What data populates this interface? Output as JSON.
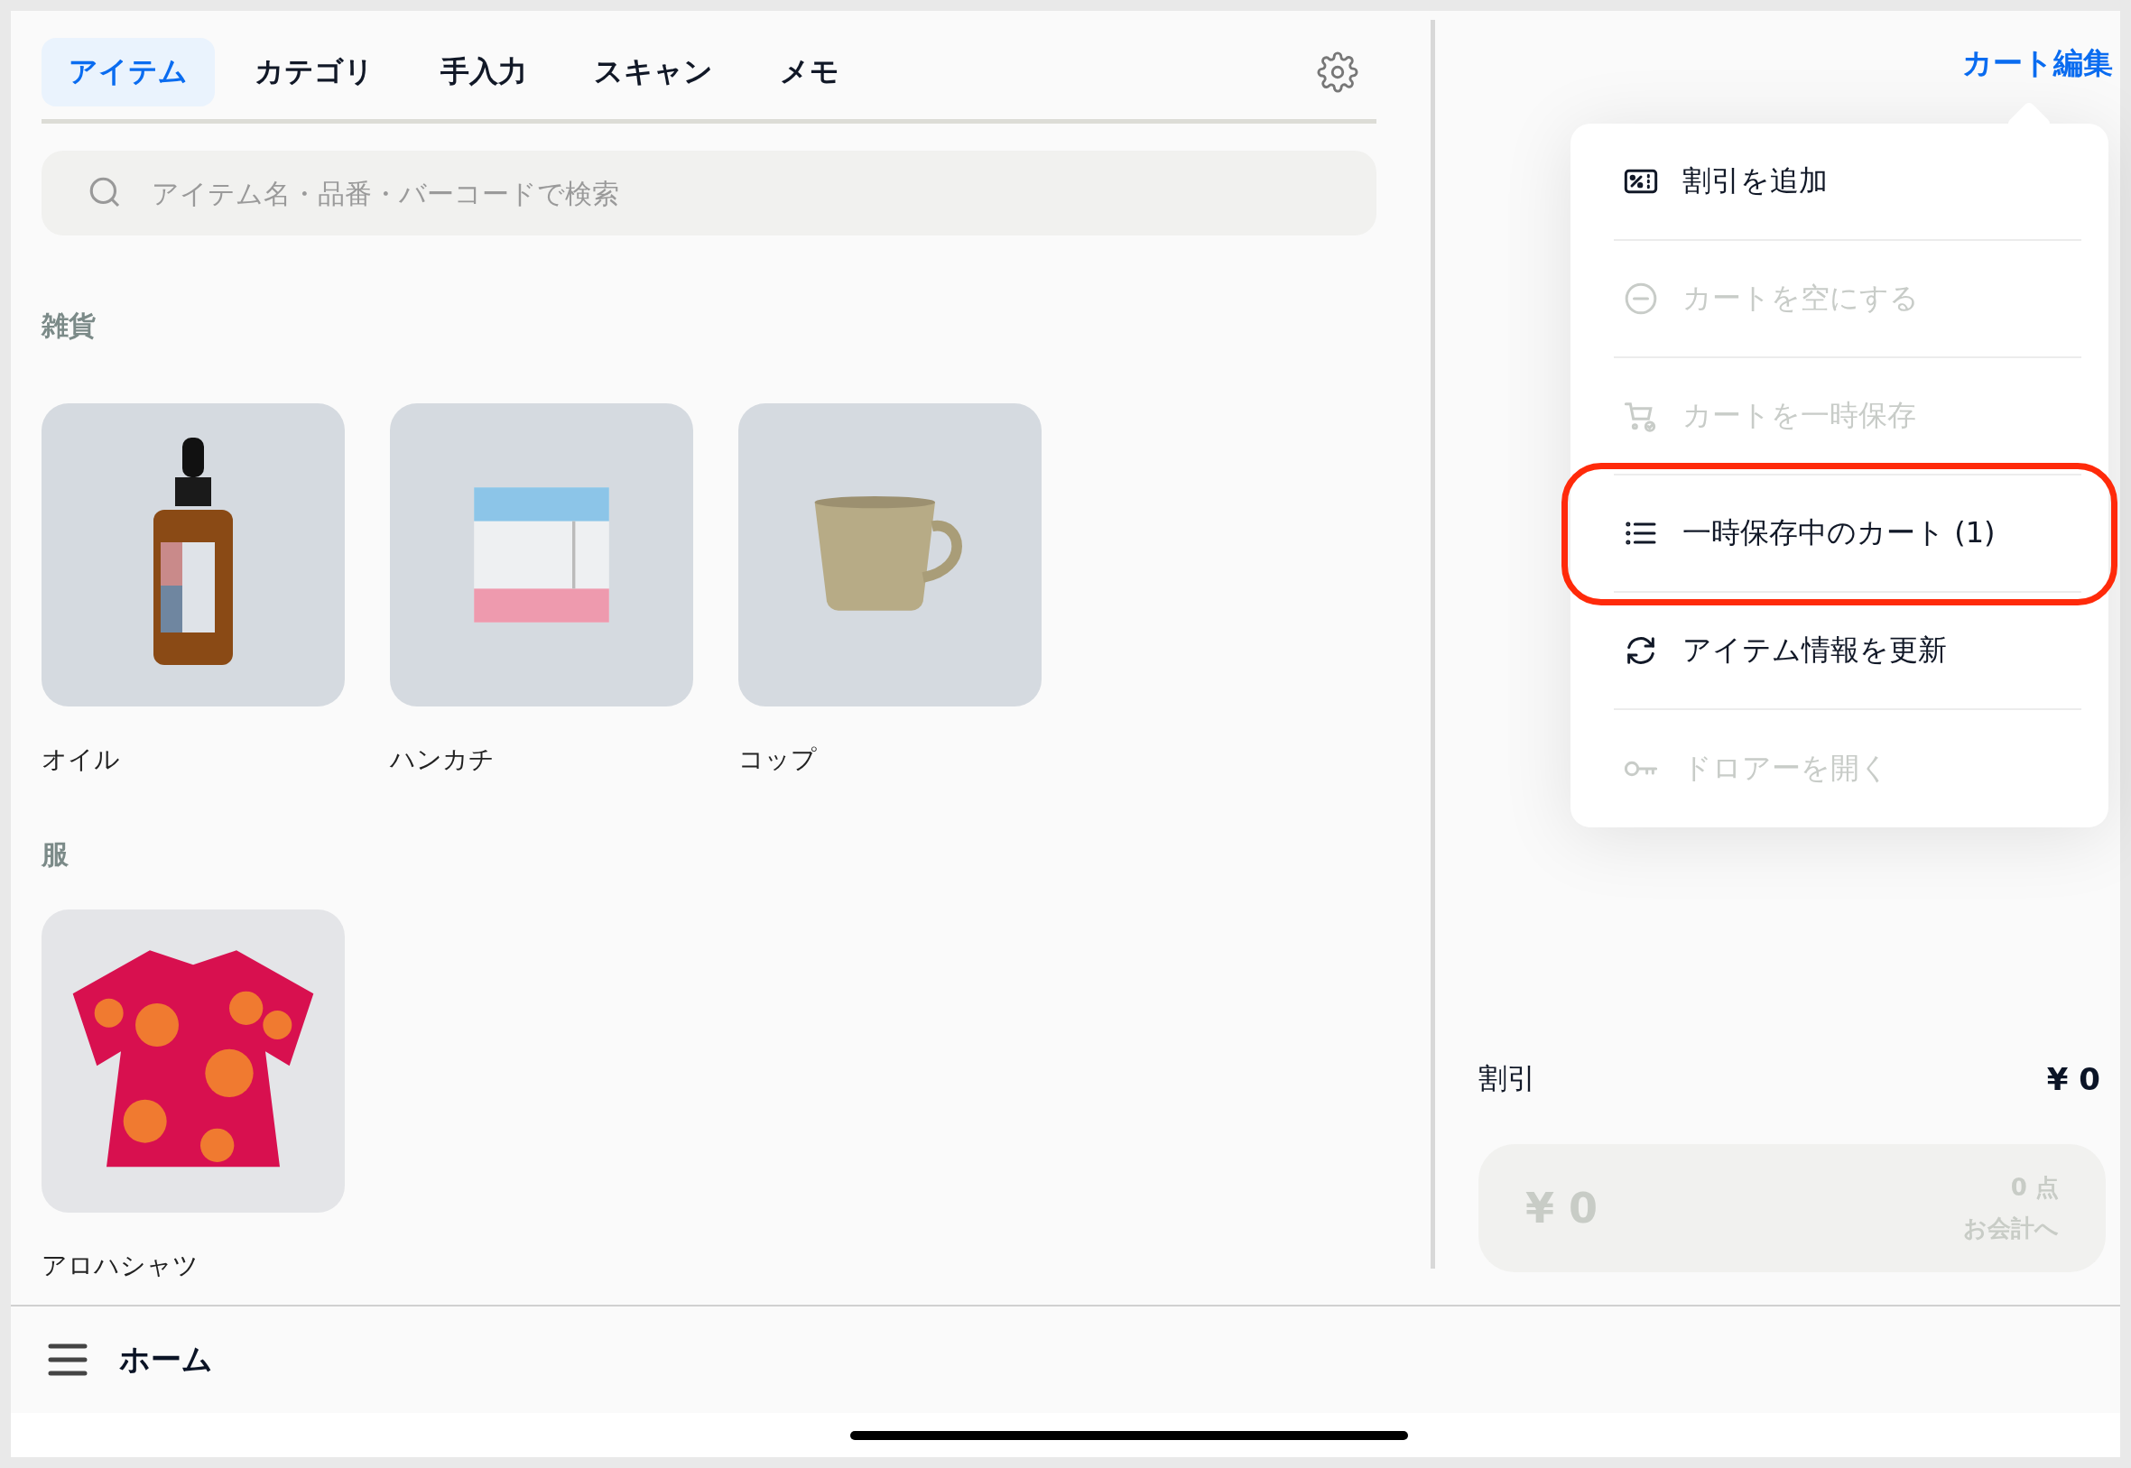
{
  "tabs": [
    {
      "label": "アイテム",
      "selected": true
    },
    {
      "label": "カテゴリ",
      "selected": false
    },
    {
      "label": "手入力",
      "selected": false
    },
    {
      "label": "スキャン",
      "selected": false
    },
    {
      "label": "メモ",
      "selected": false
    }
  ],
  "search": {
    "placeholder": "アイテム名・品番・バーコードで検索"
  },
  "sections": [
    {
      "title": "雑貨",
      "items": [
        {
          "name": "オイル",
          "kind": "oil"
        },
        {
          "name": "ハンカチ",
          "kind": "handkerchief"
        },
        {
          "name": "コップ",
          "kind": "cup"
        }
      ]
    },
    {
      "title": "服",
      "items": [
        {
          "name": "アロハシャツ",
          "kind": "shirt"
        }
      ]
    }
  ],
  "cart": {
    "edit_link": "カート編集",
    "discount_label": "割引",
    "discount_value": "¥ 0",
    "checkout": {
      "total": "¥ 0",
      "count": "0 点",
      "action": "お会計へ"
    }
  },
  "menu": {
    "items": [
      {
        "label": "割引を追加",
        "kind": "discount",
        "disabled": false,
        "highlighted": false
      },
      {
        "label": "カートを空にする",
        "kind": "clear",
        "disabled": true,
        "highlighted": false
      },
      {
        "label": "カートを一時保存",
        "kind": "hold",
        "disabled": true,
        "highlighted": false
      },
      {
        "label": "一時保存中のカート (1)",
        "kind": "held",
        "disabled": false,
        "highlighted": true
      },
      {
        "label": "アイテム情報を更新",
        "kind": "refresh",
        "disabled": false,
        "highlighted": false
      },
      {
        "label": "ドロアーを開く",
        "kind": "drawer",
        "disabled": true,
        "highlighted": false
      }
    ]
  },
  "bottom_bar": {
    "title": "ホーム"
  }
}
